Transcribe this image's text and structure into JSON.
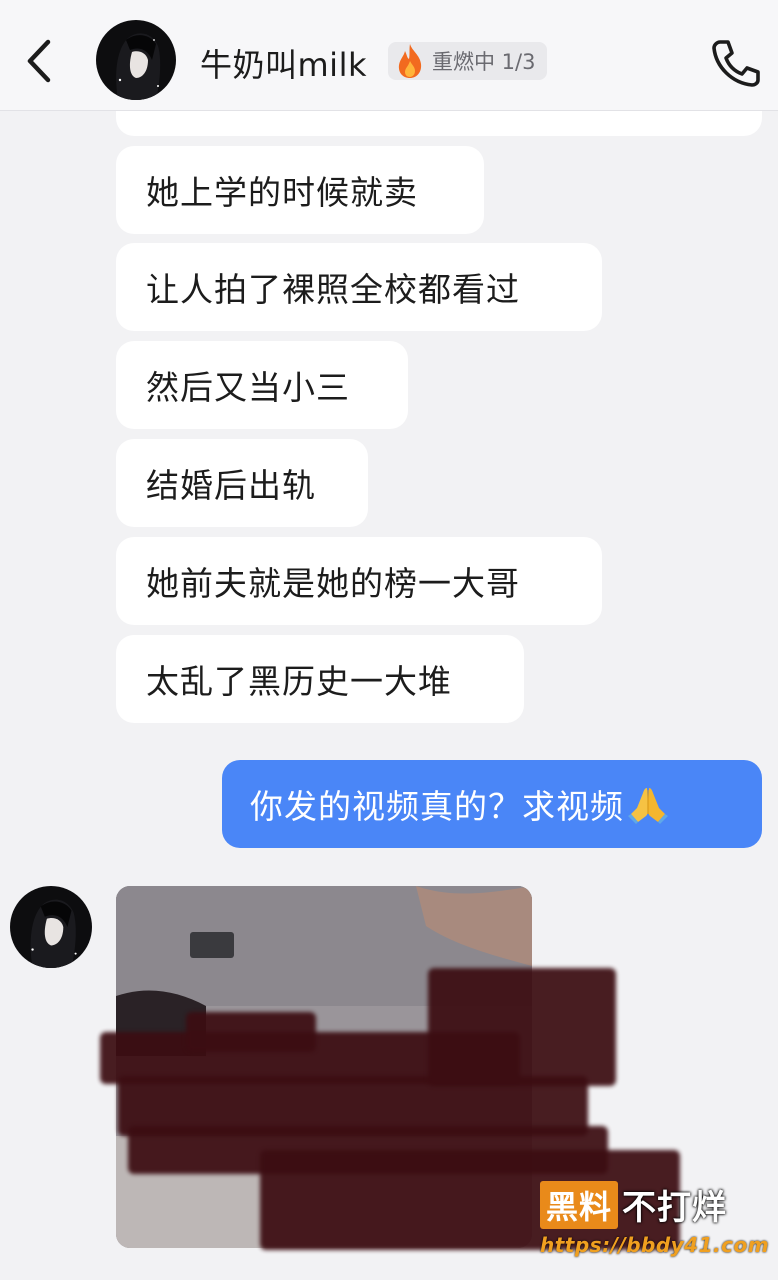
{
  "header": {
    "contact_name": "牛奶叫milk",
    "streak_text": "重燃中 1/3",
    "back_icon": "chevron-left-icon",
    "call_icon": "phone-icon",
    "streak_icon": "fire-icon"
  },
  "messages": [
    {
      "direction": "received",
      "text": "她上学的时候就卖"
    },
    {
      "direction": "received",
      "text": "让人拍了裸照全校都看过"
    },
    {
      "direction": "received",
      "text": "然后又当小三"
    },
    {
      "direction": "received",
      "text": "结婚后出轨"
    },
    {
      "direction": "received",
      "text": "她前夫就是她的榜一大哥"
    },
    {
      "direction": "received",
      "text": "太乱了黑历史一大堆"
    },
    {
      "direction": "sent",
      "text": "你发的视频真的？求视频",
      "emoji": "folded-hands-icon"
    },
    {
      "direction": "received",
      "type": "media",
      "content": "video-thumbnail-censored"
    }
  ],
  "watermark": {
    "box_text": "黑料",
    "rest_text": "不打烊",
    "url": "https://bbdy41.com"
  },
  "colors": {
    "background": "#f2f2f4",
    "sent_bubble": "#4a86f7",
    "received_bubble": "#ffffff",
    "fire": "#f26a1f",
    "watermark_orange": "#e98a1a"
  }
}
